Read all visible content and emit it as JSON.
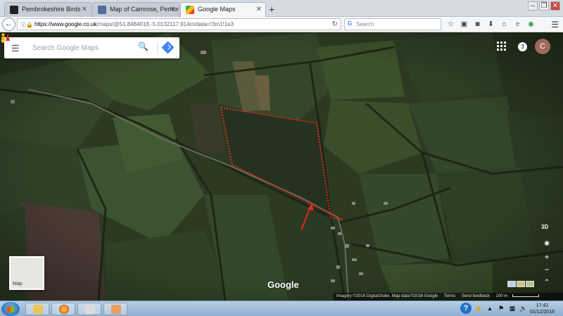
{
  "browser": {
    "tabs": [
      {
        "label": "Pembrokeshire Birds",
        "icon": "bird-favicon-icon",
        "active": false
      },
      {
        "label": "Map of Camrose, Pembrok...",
        "icon": "map-favicon-icon",
        "active": false
      },
      {
        "label": "Google Maps",
        "icon": "google-maps-favicon-icon",
        "active": true
      }
    ],
    "new_tab_symbol": "+",
    "url_host": "https://www.google.co.uk",
    "url_path": "/maps/@51.8484018,-5.0132117,914m/data=!3m1!1e3",
    "search_placeholder": "Search"
  },
  "maps": {
    "search_placeholder": "Search Google Maps",
    "notification_count": "3",
    "account_initial": "C",
    "three_d_label": "3D",
    "minimap_label": "Map",
    "logo_text": "Google",
    "footer": {
      "imagery": "Imagery ©2016 DigitalGlobe, Map data ©2016 Google",
      "terms": "Terms",
      "feedback": "Send feedback",
      "scale": "100 m"
    }
  },
  "annotation": {
    "outline_color": "#e0291f",
    "arrow_color": "#e0291f"
  },
  "taskbar": {
    "time": "17:42",
    "date": "01/12/2016",
    "apps": [
      "file-explorer-icon",
      "firefox-icon",
      "camera-app-icon",
      "paint-app-icon"
    ]
  }
}
